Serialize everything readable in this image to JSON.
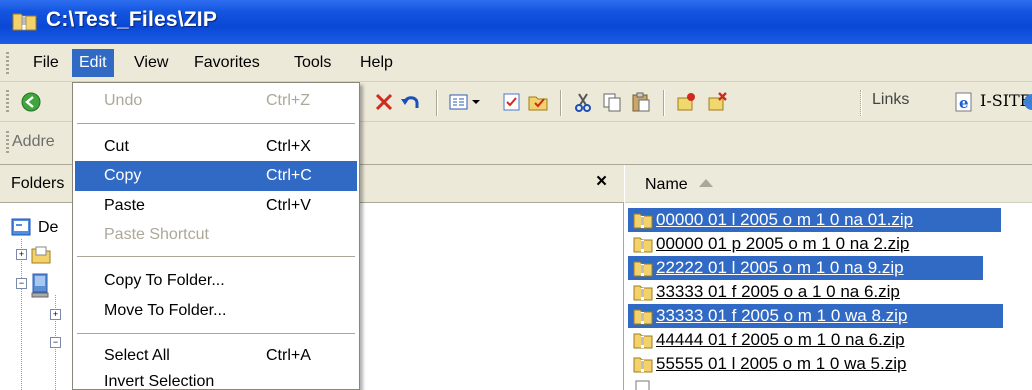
{
  "window": {
    "title": "C:\\Test_Files\\ZIP",
    "title_icon": "zip-folder-icon"
  },
  "menubar": {
    "items": [
      {
        "label": "File"
      },
      {
        "label": "Edit",
        "active": true
      },
      {
        "label": "View"
      },
      {
        "label": "Favorites"
      },
      {
        "label": "Tools"
      },
      {
        "label": "Help"
      }
    ]
  },
  "toolbar": {
    "icons": [
      "back-icon",
      "delete-icon",
      "undo-icon",
      "views-icon",
      "select-icon",
      "folder-options-icon",
      "cut-icon",
      "copy-icon",
      "paste-icon",
      "properties-icon",
      "close-properties-icon"
    ],
    "links_label": "Links",
    "isite_label": "I-SITE"
  },
  "addressbar": {
    "label": "Addre"
  },
  "folders": {
    "title": "Folders",
    "close_glyph": "×",
    "tree": [
      {
        "label": "De",
        "icon": "desktop-icon"
      }
    ]
  },
  "file_list": {
    "column_header": "Name",
    "files": [
      {
        "name": "00000 01 l 2005 o m 1 0 na 01.zip",
        "selected": true
      },
      {
        "name": "00000 01 p 2005 o m 1 0 na 2.zip",
        "selected": false
      },
      {
        "name": "22222 01 l 2005 o m 1 0 na 9.zip",
        "selected": true
      },
      {
        "name": "33333 01 f 2005 o a 1 0 na 6.zip",
        "selected": false
      },
      {
        "name": "33333 01 f 2005 o m 1 0 wa 8.zip",
        "selected": true
      },
      {
        "name": "44444 01 f 2005 o m 1 0 na 6.zip",
        "selected": false
      },
      {
        "name": "55555 01 l 2005 o m 1 0 wa 5.zip",
        "selected": false
      }
    ]
  },
  "edit_menu": {
    "items": [
      {
        "label": "Undo",
        "shortcut": "Ctrl+Z",
        "disabled": true
      },
      {
        "label": "Cut",
        "shortcut": "Ctrl+X"
      },
      {
        "label": "Copy",
        "shortcut": "Ctrl+C",
        "highlighted": true
      },
      {
        "label": "Paste",
        "shortcut": "Ctrl+V"
      },
      {
        "label": "Paste Shortcut",
        "shortcut": "",
        "disabled": true
      },
      {
        "label": "Copy To Folder..."
      },
      {
        "label": "Move To Folder..."
      },
      {
        "label": "Select All",
        "shortcut": "Ctrl+A"
      },
      {
        "label": "Invert Selection"
      }
    ]
  },
  "colors": {
    "selection": "#316ac5",
    "titlebar": "#0a48d6",
    "chrome": "#ece9d8"
  }
}
